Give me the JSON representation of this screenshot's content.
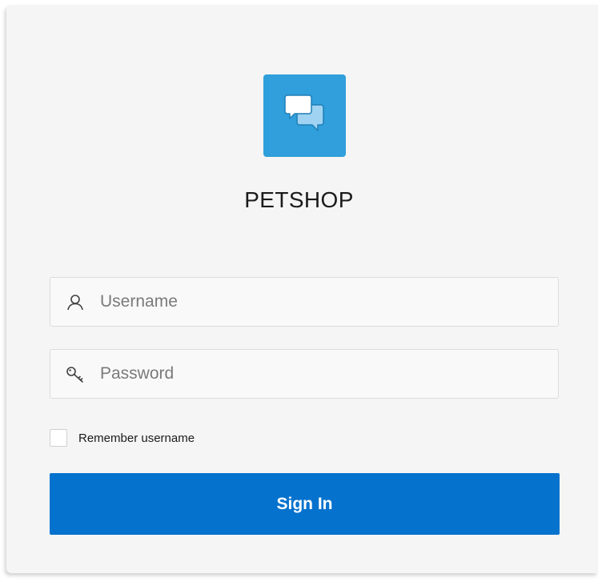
{
  "app": {
    "title": "PETSHOP",
    "logo_icon": "chat-bubbles-icon",
    "brand_color": "#309fdb"
  },
  "form": {
    "username": {
      "placeholder": "Username",
      "value": "",
      "icon": "user-icon"
    },
    "password": {
      "placeholder": "Password",
      "value": "",
      "icon": "key-icon"
    },
    "remember": {
      "label": "Remember username",
      "checked": false
    },
    "submit": {
      "label": "Sign In",
      "color": "#0572ce"
    }
  }
}
